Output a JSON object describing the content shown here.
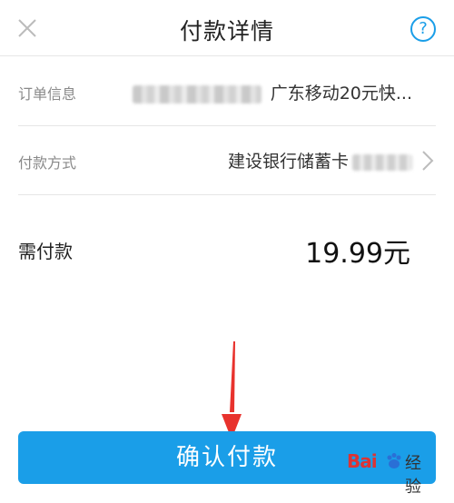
{
  "header": {
    "title": "付款详情",
    "help_label": "?"
  },
  "order": {
    "label": "订单信息",
    "value": "广东移动20元快..."
  },
  "payment_method": {
    "label": "付款方式",
    "value": "建设银行储蓄卡"
  },
  "amount": {
    "label": "需付款",
    "value": "19.99元"
  },
  "confirm_button": {
    "label": "确认付款"
  },
  "watermark": {
    "brand_left": "Bai",
    "brand_right": "经验"
  },
  "colors": {
    "accent": "#1a9ee8",
    "arrow": "#e8322d"
  }
}
